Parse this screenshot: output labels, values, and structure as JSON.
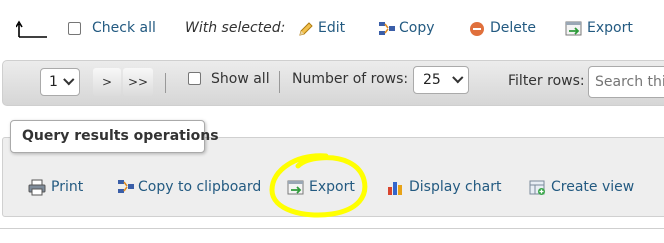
{
  "row_actions": {
    "check_all": "Check all",
    "with_selected": "With selected:",
    "edit": "Edit",
    "copy": "Copy",
    "delete": "Delete",
    "export": "Export"
  },
  "navigation": {
    "page_select": "1",
    "next_button": ">",
    "last_button": ">>",
    "show_all": "Show all",
    "rows_label": "Number of rows:",
    "rows_select": "25",
    "filter_label": "Filter rows:",
    "search_placeholder": "Search this table"
  },
  "query_ops": {
    "title": "Query results operations",
    "print": "Print",
    "copy_clipboard": "Copy to clipboard",
    "export": "Export",
    "display_chart": "Display chart",
    "create_view": "Create view"
  },
  "colors": {
    "link": "#235a81",
    "highlight_annotation": "#ffff00"
  }
}
